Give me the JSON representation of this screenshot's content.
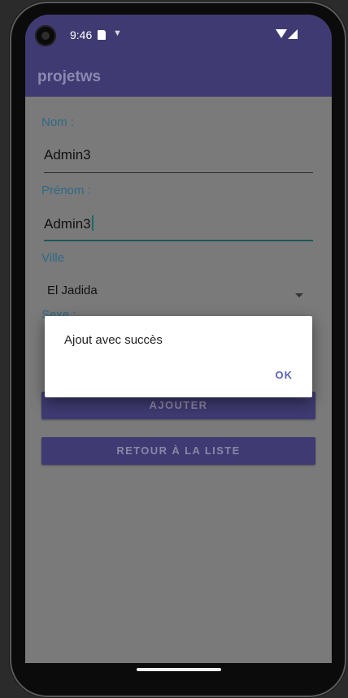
{
  "status_bar": {
    "time": "9:46"
  },
  "app_bar": {
    "title": "projetws"
  },
  "form": {
    "nom_label": "Nom :",
    "nom_value": "Admin3",
    "prenom_label": "Prénom :",
    "prenom_value": "Admin3",
    "ville_label": "Ville",
    "ville_value": "El Jadida",
    "sexe_label": "Sexe :"
  },
  "buttons": {
    "ajouter": "AJOUTER",
    "retour": "RETOUR À LA LISTE"
  },
  "dialog": {
    "message": "Ajout avec succès",
    "ok": "OK"
  },
  "colors": {
    "primary": "#3f3a71",
    "accent": "#1d6a6a",
    "dialog_button": "#5b63b8"
  }
}
